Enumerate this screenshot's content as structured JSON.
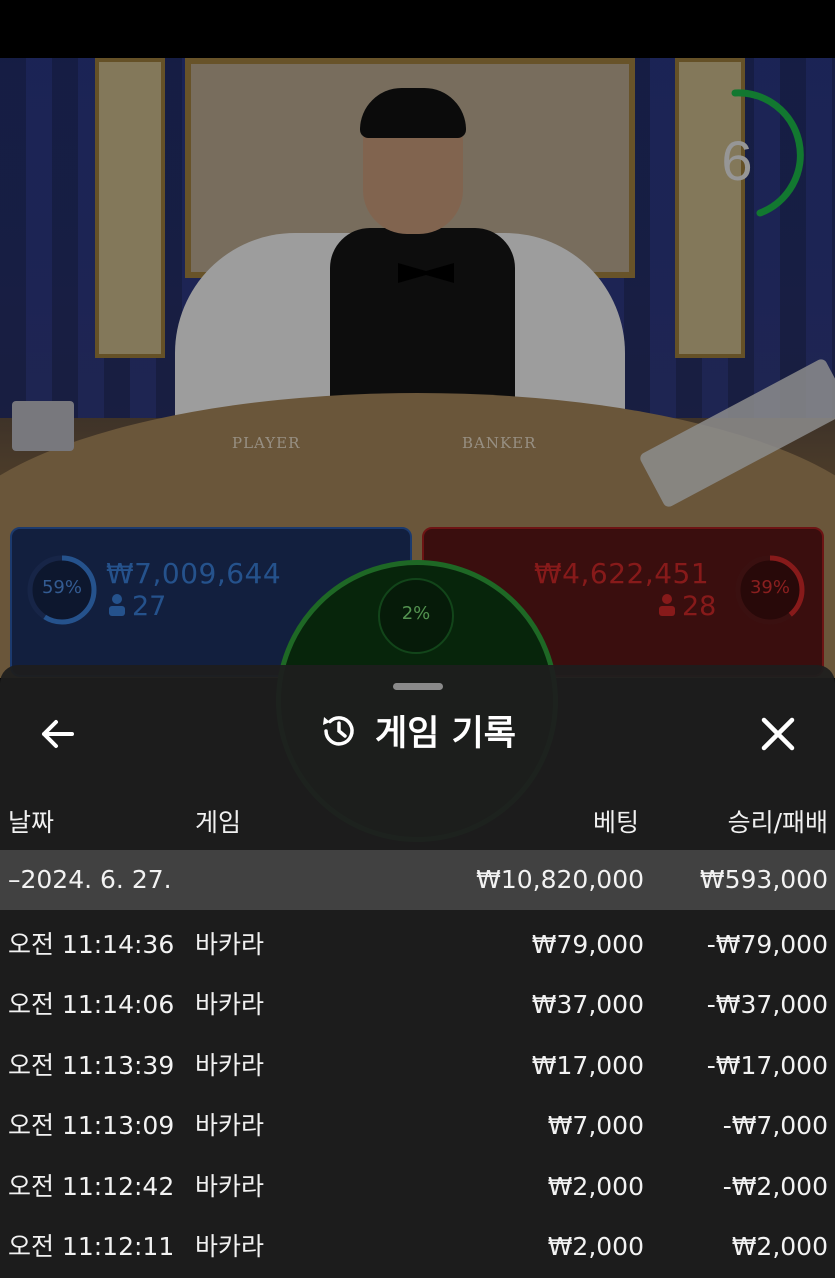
{
  "video": {
    "table_labels": {
      "player": "PLAYER",
      "banker": "BANKER"
    },
    "timer": {
      "value": "6",
      "color": "#1db84a"
    }
  },
  "betting": {
    "player": {
      "percent": "59%",
      "amount": "₩7,009,644",
      "count": "27",
      "color": "#3a7ed8",
      "fill_fraction": 0.59
    },
    "tie": {
      "percent": "2%",
      "color": "#2ea03a"
    },
    "banker": {
      "percent": "39%",
      "amount": "₩4,622,451",
      "count": "28",
      "color": "#d02828",
      "fill_fraction": 0.39
    }
  },
  "history": {
    "title": "게임 기록",
    "icons": {
      "back": "arrow-left-icon",
      "history": "history-icon",
      "close": "close-icon"
    },
    "columns": {
      "date": "날짜",
      "game": "게임",
      "bet": "베팅",
      "result": "승리/패배"
    },
    "summary": {
      "date": "–2024. 6. 27.",
      "bet": "₩10,820,000",
      "result": "₩593,000"
    },
    "rows": [
      {
        "time": "오전 11:14:36",
        "game": "바카라",
        "bet": "₩79,000",
        "result": "-₩79,000"
      },
      {
        "time": "오전 11:14:06",
        "game": "바카라",
        "bet": "₩37,000",
        "result": "-₩37,000"
      },
      {
        "time": "오전 11:13:39",
        "game": "바카라",
        "bet": "₩17,000",
        "result": "-₩17,000"
      },
      {
        "time": "오전 11:13:09",
        "game": "바카라",
        "bet": "₩7,000",
        "result": "-₩7,000"
      },
      {
        "time": "오전 11:12:42",
        "game": "바카라",
        "bet": "₩2,000",
        "result": "-₩2,000"
      },
      {
        "time": "오전 11:12:11",
        "game": "바카라",
        "bet": "₩2,000",
        "result": "₩2,000"
      }
    ]
  }
}
